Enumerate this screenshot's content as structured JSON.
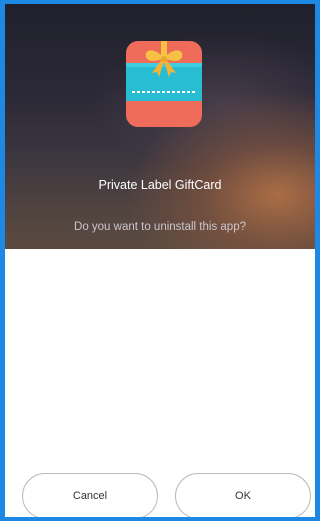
{
  "dialog": {
    "app_name": "Private Label GiftCard",
    "question": "Do you want to uninstall this app?"
  },
  "buttons": {
    "cancel_label": "Cancel",
    "ok_label": "OK"
  },
  "icon": {
    "name": "gift-card-icon",
    "colors": {
      "background": "#ef6c5a",
      "card": "#29bdd3",
      "ribbon": "#f7c244",
      "frame_border": "#1e88e5"
    }
  }
}
